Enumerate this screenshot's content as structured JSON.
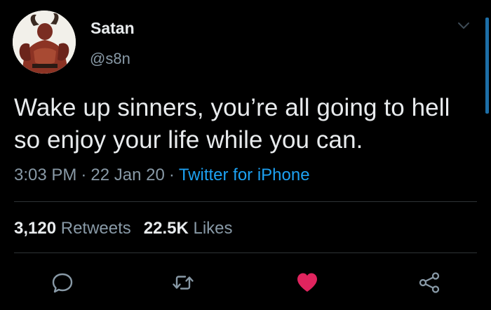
{
  "user": {
    "display_name": "Satan",
    "handle": "@s8n",
    "avatar_icon": "demon-avatar"
  },
  "tweet": {
    "text_line1": "Wake up sinners, you’re all going to hell",
    "text_line2": "so enjoy your life while you can.",
    "time": "3:03 PM",
    "date": "22 Jan 20",
    "separator": "·",
    "source": "Twitter for iPhone"
  },
  "stats": {
    "retweets_count": "3,120",
    "retweets_label": "Retweets",
    "likes_count": "22.5K",
    "likes_label": "Likes"
  },
  "actions": [
    {
      "name": "reply",
      "icon": "reply-icon"
    },
    {
      "name": "retweet",
      "icon": "retweet-icon"
    },
    {
      "name": "like",
      "icon": "heart-icon",
      "active": true
    },
    {
      "name": "share",
      "icon": "share-icon"
    }
  ],
  "colors": {
    "background": "#000000",
    "text": "#e8ebed",
    "muted": "#8899a6",
    "link": "#1da1f2",
    "like": "#e0245e",
    "divider": "#2f3336"
  }
}
